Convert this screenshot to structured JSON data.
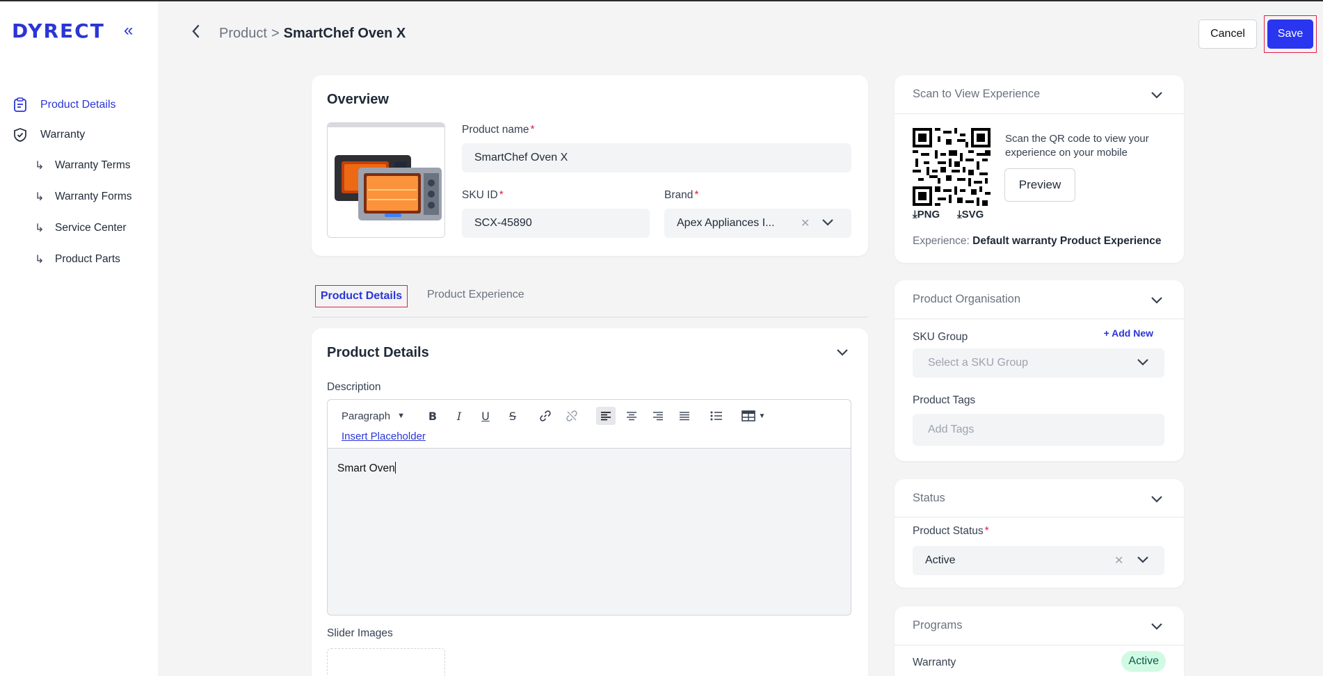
{
  "app": {
    "logo": "DYRECT"
  },
  "sidebar": {
    "items": [
      {
        "label": "Product Details",
        "icon": "clipboard-icon",
        "active": true
      },
      {
        "label": "Warranty",
        "icon": "shield-check-icon",
        "active": false
      }
    ],
    "sub_items": [
      {
        "label": "Warranty Terms"
      },
      {
        "label": "Warranty Forms"
      },
      {
        "label": "Service Center"
      },
      {
        "label": "Product Parts"
      }
    ]
  },
  "header": {
    "breadcrumb_parent": "Product",
    "breadcrumb_sep": ">",
    "breadcrumb_current": "SmartChef Oven X",
    "cancel_label": "Cancel",
    "save_label": "Save"
  },
  "overview": {
    "title": "Overview",
    "product_name_label": "Product name",
    "product_name_value": "SmartChef Oven X",
    "sku_label": "SKU ID",
    "sku_value": "SCX-45890",
    "brand_label": "Brand",
    "brand_value": "Apex Appliances I..."
  },
  "tabs": [
    {
      "label": "Product Details",
      "active": true
    },
    {
      "label": "Product Experience",
      "active": false
    }
  ],
  "details": {
    "title": "Product Details",
    "description_label": "Description",
    "paragraph_select": "Paragraph",
    "insert_placeholder": "Insert Placeholder",
    "editor_text": "Smart Oven",
    "slider_label": "Slider Images"
  },
  "scan": {
    "title": "Scan to View Experience",
    "text": "Scan the QR code to view your experience on your mobile",
    "preview_label": "Preview",
    "png_label": "PNG",
    "svg_label": "SVG",
    "experience_label": "Experience:",
    "experience_value": "Default warranty Product Experience"
  },
  "organisation": {
    "title": "Product Organisation",
    "sku_group_label": "SKU Group",
    "add_new": "+ Add New",
    "sku_group_placeholder": "Select a SKU Group",
    "tags_label": "Product Tags",
    "tags_placeholder": "Add Tags"
  },
  "status": {
    "title": "Status",
    "product_status_label": "Product Status",
    "product_status_value": "Active"
  },
  "programs": {
    "title": "Programs",
    "warranty_label": "Warranty",
    "warranty_status": "Active"
  },
  "colors": {
    "accent": "#2a35f0",
    "brand": "#2a35d6",
    "highlight_border": "#e11d48",
    "badge_bg": "#d1fae5"
  }
}
